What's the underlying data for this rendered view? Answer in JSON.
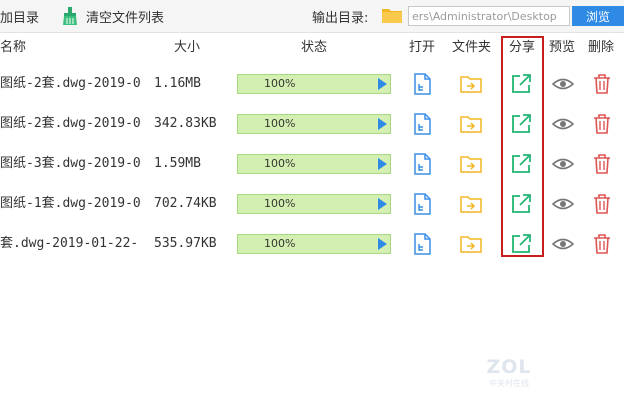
{
  "toolbar": {
    "add_dir_label": "加目录",
    "clear_list_label": "清空文件列表",
    "output_dir_label": "输出目录:",
    "output_path_value": "ers\\Administrator\\Desktop",
    "browse_label": "浏览"
  },
  "table": {
    "headers": {
      "name": "名称",
      "size": "大小",
      "status": "状态",
      "open": "打开",
      "folder": "文件夹",
      "share": "分享",
      "preview": "预览",
      "delete": "删除"
    },
    "rows": [
      {
        "name": "图纸-2套.dwg-2019-0",
        "size": "1.16MB",
        "progress_text": "100%",
        "progress": 1.0
      },
      {
        "name": "图纸-2套.dwg-2019-0",
        "size": "342.83KB",
        "progress_text": "100%",
        "progress": 1.0
      },
      {
        "name": "图纸-3套.dwg-2019-0",
        "size": "1.59MB",
        "progress_text": "100%",
        "progress": 1.0
      },
      {
        "name": "图纸-1套.dwg-2019-0",
        "size": "702.74KB",
        "progress_text": "100%",
        "progress": 1.0
      },
      {
        "name": "套.dwg-2019-01-22-",
        "size": "535.97KB",
        "progress_text": "100%",
        "progress": 1.0
      }
    ]
  },
  "watermark": {
    "logo": "ZOL",
    "tagline": "中关村在线"
  },
  "colors": {
    "accent": "#2f8ae6",
    "folder": "#f2b622",
    "share": "#22b573",
    "delete": "#e05454",
    "highlight": "#c81e1e",
    "progress_bg": "#dff5c5",
    "progress_border": "#a7d77e"
  },
  "icons": {
    "clear": "broom-icon",
    "output_folder": "folder-icon",
    "open": "open-file-icon",
    "folder": "folder-arrow-icon",
    "share": "share-icon",
    "preview": "eye-icon",
    "delete": "trash-icon",
    "progress_play": "play-icon"
  }
}
